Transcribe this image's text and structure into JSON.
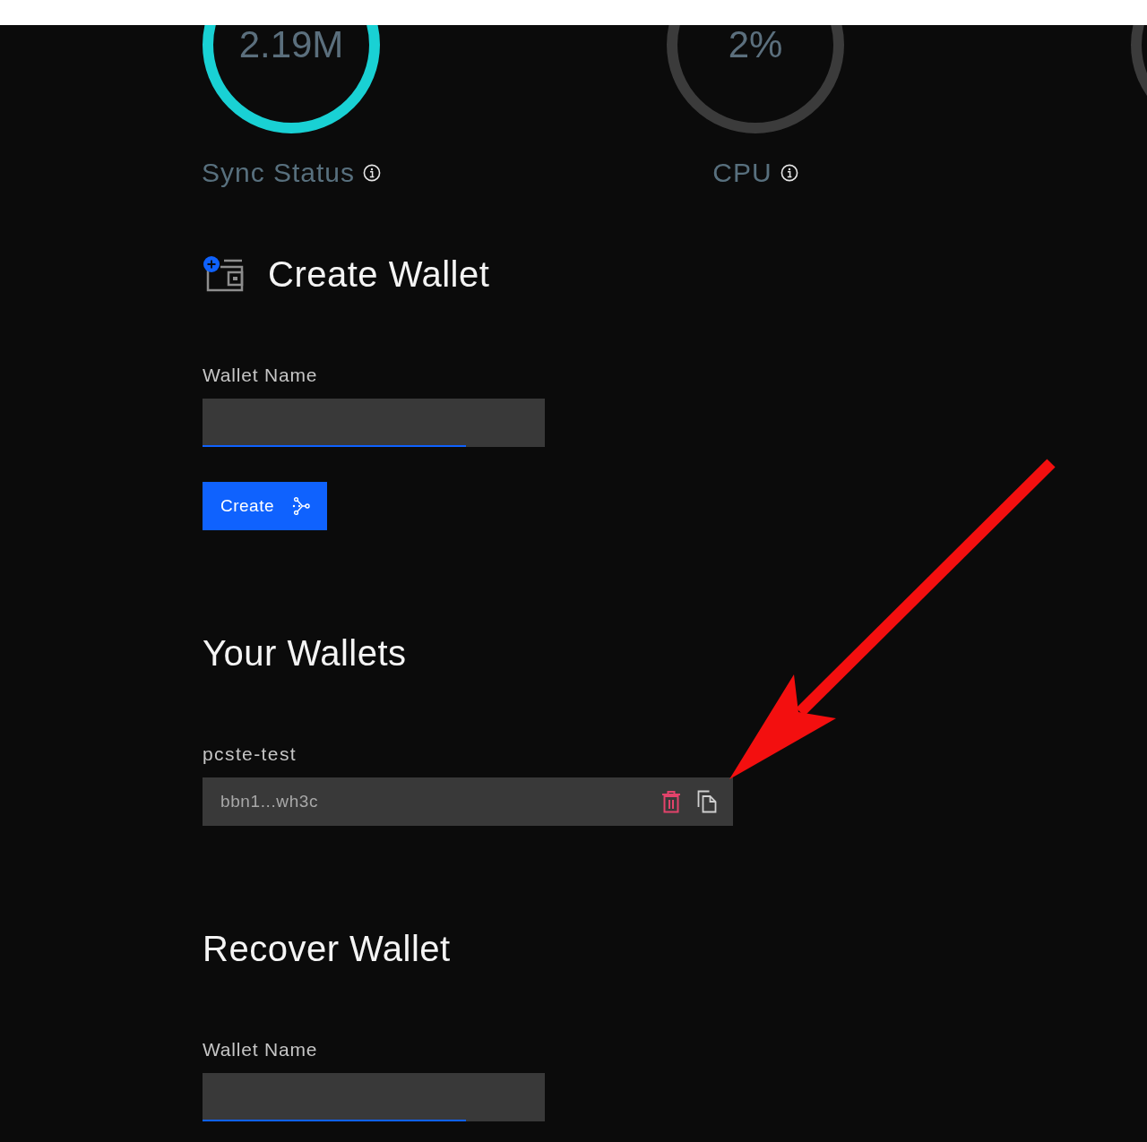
{
  "gauges": [
    {
      "value": "2.19M",
      "label": "Sync Status",
      "color": "#19d1d4"
    },
    {
      "value": "2%",
      "label": "CPU",
      "color": "#3b3b3b"
    },
    {
      "color": "#3b3b3b"
    }
  ],
  "create_wallet": {
    "title": "Create Wallet",
    "field": {
      "label": "Wallet Name"
    },
    "button": {
      "label": "Create"
    }
  },
  "your_wallets": {
    "title": "Your Wallets",
    "wallets": [
      {
        "name": "pcste-test",
        "address": "bbn1...wh3c"
      }
    ]
  },
  "recover_wallet": {
    "title": "Recover Wallet",
    "field": {
      "label": "Wallet Name"
    }
  }
}
